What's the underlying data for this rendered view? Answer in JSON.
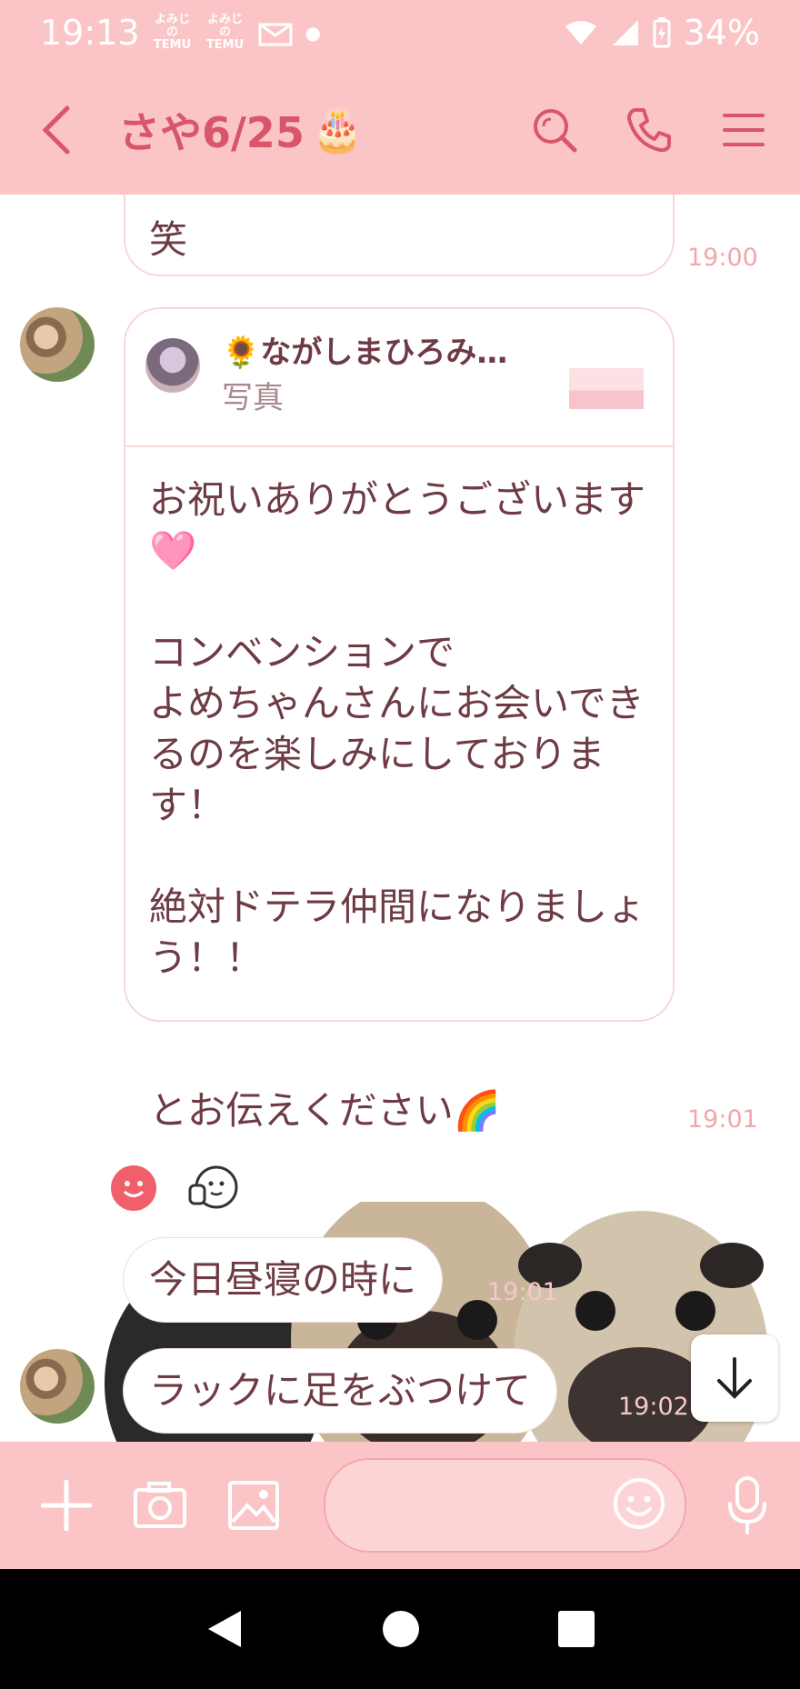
{
  "status_bar": {
    "time": "19:13",
    "notif1": "TEMU",
    "notif2": "TEMU",
    "battery": "34%"
  },
  "header": {
    "title": "さや6/25",
    "title_emoji": "🎂"
  },
  "messages": {
    "partial_text": "笑",
    "partial_time": "19:00",
    "reply_name": "🌻ながしまひろみ…",
    "reply_type": "写真",
    "main_text": "お祝いありがとうございます🩷\n\nコンベンションで\nよめちゃんさんにお会いできるのを楽しみにしております！\n\n絶対ドテラ仲間になりましょう！！\n\n\nとお伝えください🌈",
    "main_time": "19:01",
    "msg3_text": "今日昼寝の時に",
    "msg3_time": "19:01",
    "msg4_text": "ラックに足をぶつけて",
    "msg4_time": "19:02"
  },
  "colors": {
    "header_bg": "#fbc5c7",
    "accent": "#d9566a",
    "text": "#6e3b44",
    "time": "#f2a6ad"
  },
  "icons": {
    "back": "chevron-left-icon",
    "search": "search-icon",
    "call": "phone-icon",
    "menu": "menu-icon",
    "plus": "plus-icon",
    "camera": "camera-icon",
    "image": "image-icon",
    "emoji": "emoji-icon",
    "mic": "mic-icon",
    "scroll": "arrow-down-icon"
  }
}
